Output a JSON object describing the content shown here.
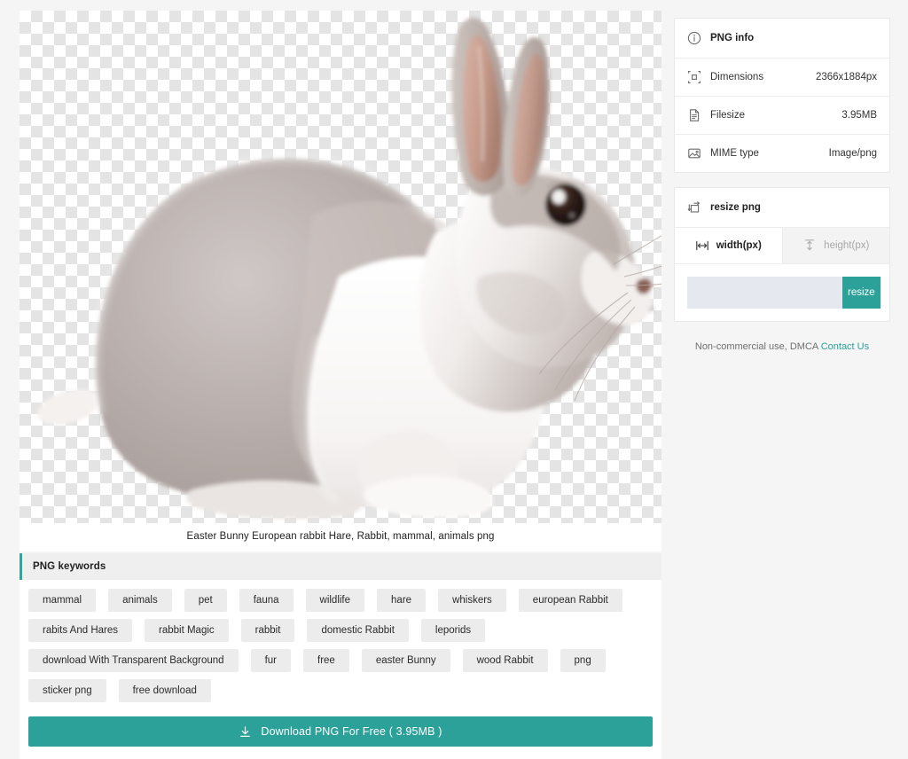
{
  "preview": {
    "caption": "Easter Bunny European rabbit Hare, Rabbit, mammal, animals png",
    "alt": "rabbit-photo"
  },
  "keywords": {
    "header": "PNG keywords",
    "tags": [
      "mammal",
      "animals",
      "pet",
      "fauna",
      "wildlife",
      "hare",
      "whiskers",
      "european Rabbit",
      "rabits And Hares",
      "rabbit Magic",
      "rabbit",
      "domestic Rabbit",
      "leporids",
      "download With Transparent Background",
      "fur",
      "free",
      "easter Bunny",
      "wood Rabbit",
      "png",
      "sticker png",
      "free download"
    ]
  },
  "download": {
    "label": "Download PNG For Free ( 3.95MB )",
    "icon": "download-icon"
  },
  "png_info": {
    "header": "PNG info",
    "header_icon": "info-circle-icon",
    "rows": [
      {
        "icon": "dimensions-icon",
        "label": "Dimensions",
        "value": "2366x1884px"
      },
      {
        "icon": "file-icon",
        "label": "Filesize",
        "value": "3.95MB"
      },
      {
        "icon": "image-icon",
        "label": "MIME type",
        "value": "Image/png"
      }
    ]
  },
  "resize": {
    "header": "resize png",
    "header_icon": "resize-icon",
    "tabs": [
      {
        "label": "width(px)",
        "icon": "horizontal-arrow-icon",
        "active": true
      },
      {
        "label": "height(px)",
        "icon": "vertical-arrow-icon",
        "active": false
      }
    ],
    "input_value": "",
    "input_placeholder": "",
    "button_label": "resize"
  },
  "footer": {
    "text": "Non-commercial use, DMCA ",
    "link": "Contact Us"
  },
  "colors": {
    "accent": "#2ba199",
    "input_bg": "#e6e8ef",
    "tag_bg": "#ececec",
    "page_bg": "#f5f5f5"
  }
}
